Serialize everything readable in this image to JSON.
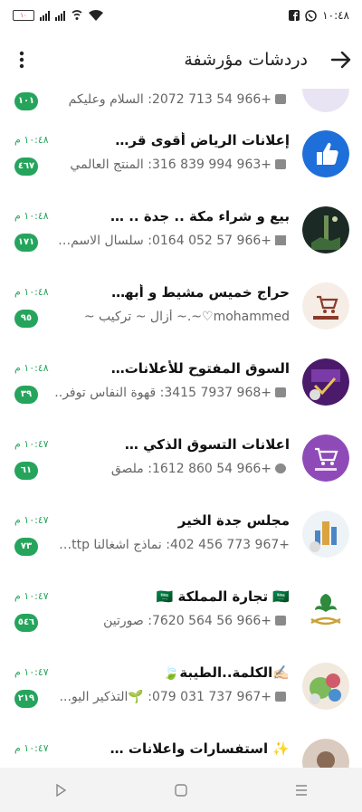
{
  "status_bar": {
    "time": "١٠:٤٨",
    "battery": "١٠",
    "icons": [
      "facebook-icon",
      "whatsapp-icon",
      "signal-icon",
      "wifi-icon"
    ]
  },
  "header": {
    "title": "دردشات مؤرشفة",
    "icons": [
      "back-arrow-icon",
      "more-vert-icon"
    ]
  },
  "chats": [
    {
      "name": "",
      "preview": "+966 54 713 2072: السلام وعليكم",
      "badge": "١٠١",
      "time": "",
      "avatar": "avatar-pale"
    },
    {
      "name": "إعلانات   الرياض أقوى قروب إعلانات...",
      "preview": "+963 994 839 316: المنتج العالمي",
      "badge": "٤٦٧",
      "time": "١٠:٤٨ م",
      "avatar": "thumbs-up-avatar"
    },
    {
      "name": "بيع و شراء مكة .. جدة .. الطائف",
      "preview": "+966 57 052 0164: سلسال الاسم ب..",
      "badge": "١٧١",
      "time": "١٠:٤٨ م",
      "avatar": "night-photo-avatar"
    },
    {
      "name": "حراج خميس مشيط و أبها🛍️⚫🟣⚫",
      "preview": "mohammed♡~.~ أزال ~ تركيب ~",
      "badge": "٩٥",
      "time": "١٠:٤٨ م",
      "avatar": "haraj-khamis-avatar"
    },
    {
      "name": "السوق المفتوح للأعلانات التجارة💚 ...",
      "preview": "+968 7937 3415: قهوة النفاس توفر..",
      "badge": "٣٩",
      "time": "١٠:٤٨ م",
      "avatar": "open-market-avatar"
    },
    {
      "name": "اعلانات التسوق الذكي 🛒⚫🟣",
      "preview": "+966 54 860 1612: ملصق",
      "badge": "٦١",
      "time": "١٠:٤٧ م",
      "avatar": "smart-shopping-avatar"
    },
    {
      "name": "مجلس جدة الخير",
      "preview": "+967 773 456 402: نماذج اشغالنا http...",
      "badge": "٧٣",
      "time": "١٠:٤٧ م",
      "avatar": "jeddah-council-avatar"
    },
    {
      "name": "🇸🇦 تجارة المملكة 🇸🇦",
      "preview": "+966 56 564 7620: صورتين",
      "badge": "٥٤٦",
      "time": "١٠:٤٧ م",
      "avatar": "saudi-emblem-avatar"
    },
    {
      "name": "✍🏻الكلمة..الطيبة🍃",
      "preview": "+967 737 031 079: 🌱التذكير اليو...",
      "badge": "٢١٩",
      "time": "١٠:٤٧ م",
      "avatar": "good-word-avatar"
    },
    {
      "name": "✨ استفسارات واعلانات بنات ✨",
      "preview": "",
      "badge": "",
      "time": "١٠:٤٧ م",
      "avatar": "girls-ads-avatar"
    }
  ],
  "nav": {
    "icons": [
      "nav-back-icon",
      "nav-home-icon",
      "nav-recents-icon"
    ]
  }
}
